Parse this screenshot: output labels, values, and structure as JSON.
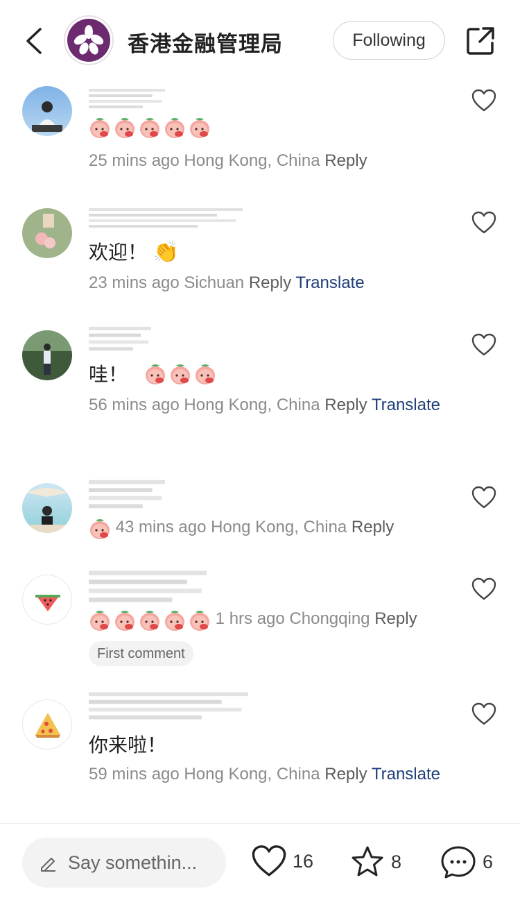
{
  "header": {
    "account_name": "香港金融管理局",
    "follow_label": "Following"
  },
  "comments": [
    {
      "text": "",
      "time": "25 mins ago",
      "location": "Hong Kong, China",
      "reply": "Reply",
      "translate": ""
    },
    {
      "text": "欢迎！",
      "time": "23 mins ago",
      "location": "Sichuan",
      "reply": "Reply",
      "translate": "Translate"
    },
    {
      "text": "哇！",
      "time": "56 mins ago",
      "location": "Hong Kong, China",
      "reply": "Reply",
      "translate": "Translate"
    },
    {
      "text": "",
      "time": "43 mins ago",
      "location": "Hong Kong, China",
      "reply": "Reply",
      "translate": ""
    },
    {
      "text": "",
      "time": "1 hrs ago",
      "location": "Chongqing",
      "reply": "Reply",
      "translate": "",
      "badge": "First comment"
    },
    {
      "text": "你来啦！",
      "time": "59 mins ago",
      "location": "Hong Kong, China",
      "reply": "Reply",
      "translate": "Translate"
    }
  ],
  "bottom_bar": {
    "input_placeholder": "Say somethin...",
    "likes": "16",
    "stars": "8",
    "comments": "6"
  },
  "colors": {
    "translate": "#1f3f78",
    "meta": "#8a8a8a",
    "brand_purple": "#6c2a6f"
  }
}
